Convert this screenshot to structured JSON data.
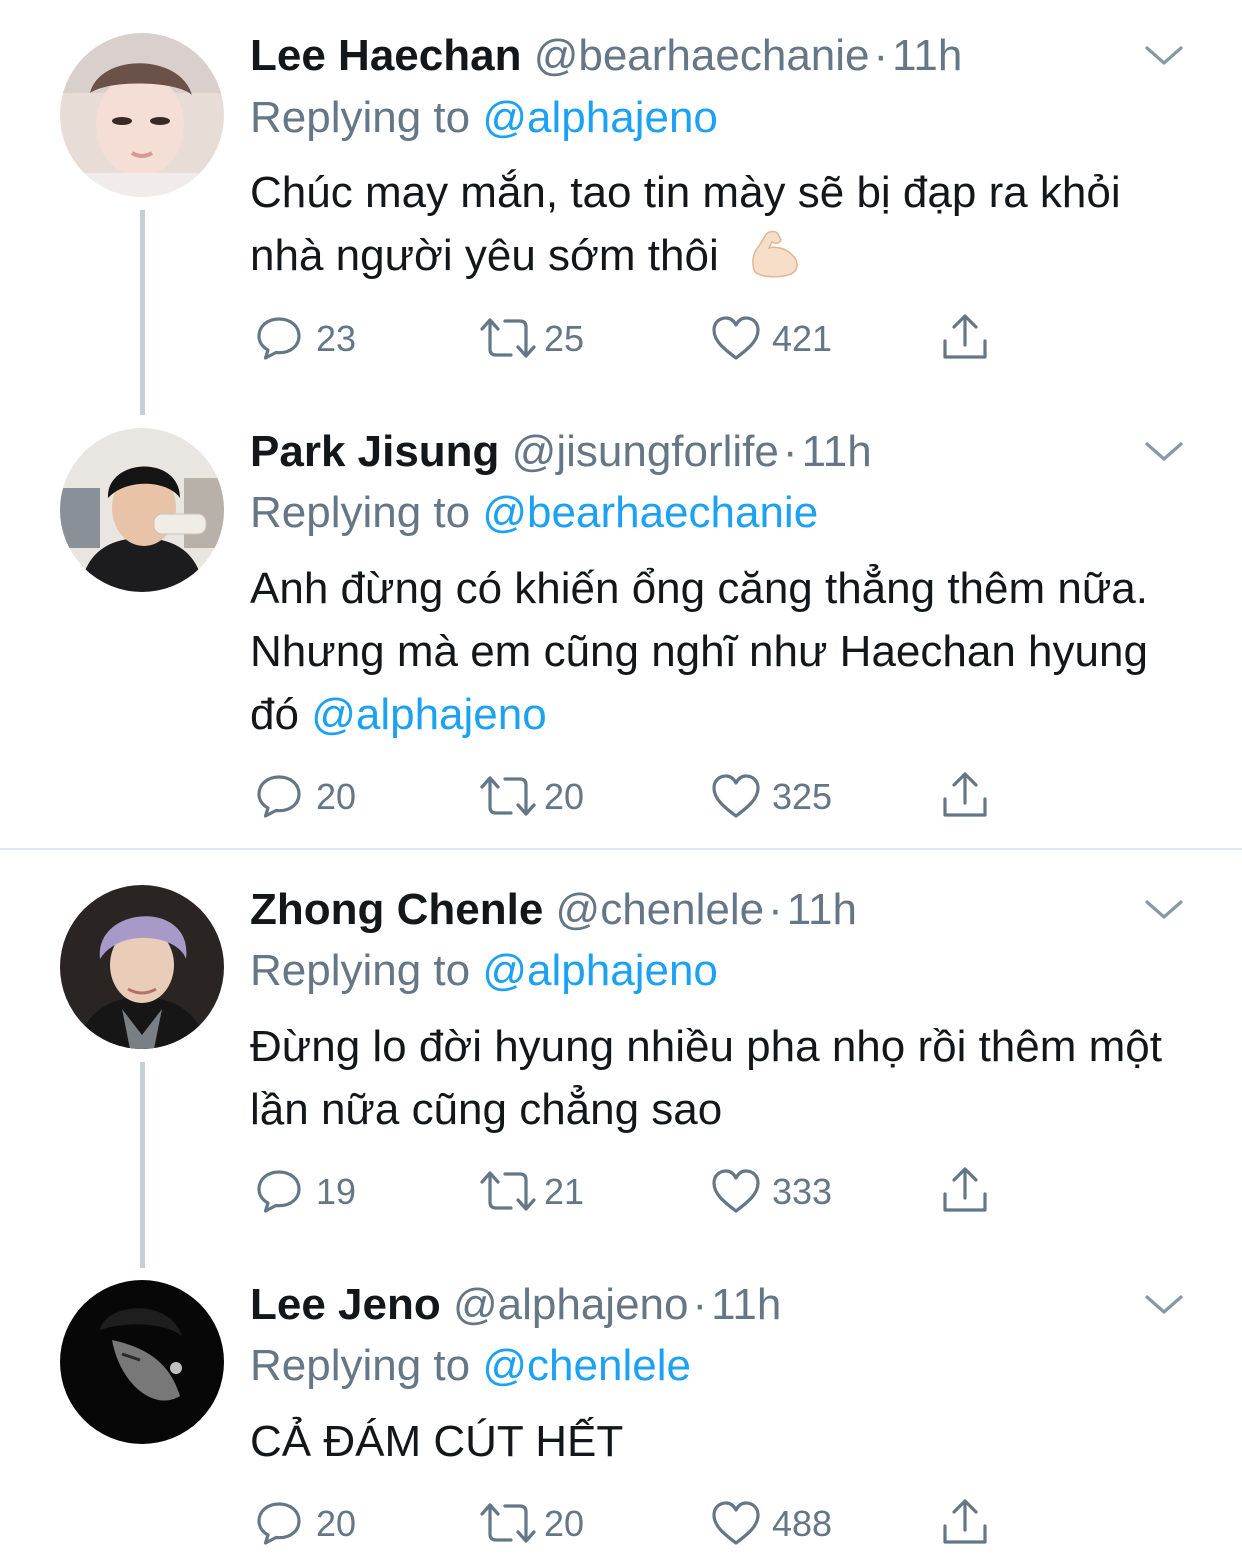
{
  "colors": {
    "link": "#1da1f2",
    "muted": "#657786",
    "text": "#14171a",
    "divider": "#e1e8ed",
    "thread": "#c4cfd6"
  },
  "icons": [
    "reply-icon",
    "retweet-icon",
    "like-icon",
    "share-icon",
    "chevron-down-icon",
    "flexed-biceps-emoji"
  ],
  "tweets": [
    {
      "name": "Lee Haechan",
      "handle": "@bearhaechanie",
      "separator": "·",
      "time": "11h",
      "replying_prefix": "Replying to",
      "replying_to": "@alphajeno",
      "text": "Chúc may mắn, tao tin mày sẽ bị đạp ra khỏi nhà người yêu sớm thôi",
      "emoji": "💪🏻",
      "replies": "23",
      "retweets": "25",
      "likes": "421"
    },
    {
      "name": "Park Jisung",
      "handle": "@jisungforlife",
      "separator": "·",
      "time": "11h",
      "replying_prefix": "Replying to",
      "replying_to": "@bearhaechanie",
      "text": "Anh đừng có khiến ổng căng thẳng thêm nữa. Nhưng mà em cũng nghĩ như Haechan hyung đó",
      "mention": "@alphajeno",
      "replies": "20",
      "retweets": "20",
      "likes": "325"
    },
    {
      "name": "Zhong Chenle",
      "handle": "@chenlele",
      "separator": "·",
      "time": "11h",
      "replying_prefix": "Replying to",
      "replying_to": "@alphajeno",
      "text": "Đừng lo đời hyung nhiều pha nhọ rồi thêm một lần nữa cũng chẳng sao",
      "replies": "19",
      "retweets": "21",
      "likes": "333"
    },
    {
      "name": "Lee Jeno",
      "handle": "@alphajeno",
      "separator": "·",
      "time": "11h",
      "replying_prefix": "Replying to",
      "replying_to": "@chenlele",
      "text": "CẢ ĐÁM CÚT HẾT",
      "replies": "20",
      "retweets": "20",
      "likes": "488"
    }
  ]
}
